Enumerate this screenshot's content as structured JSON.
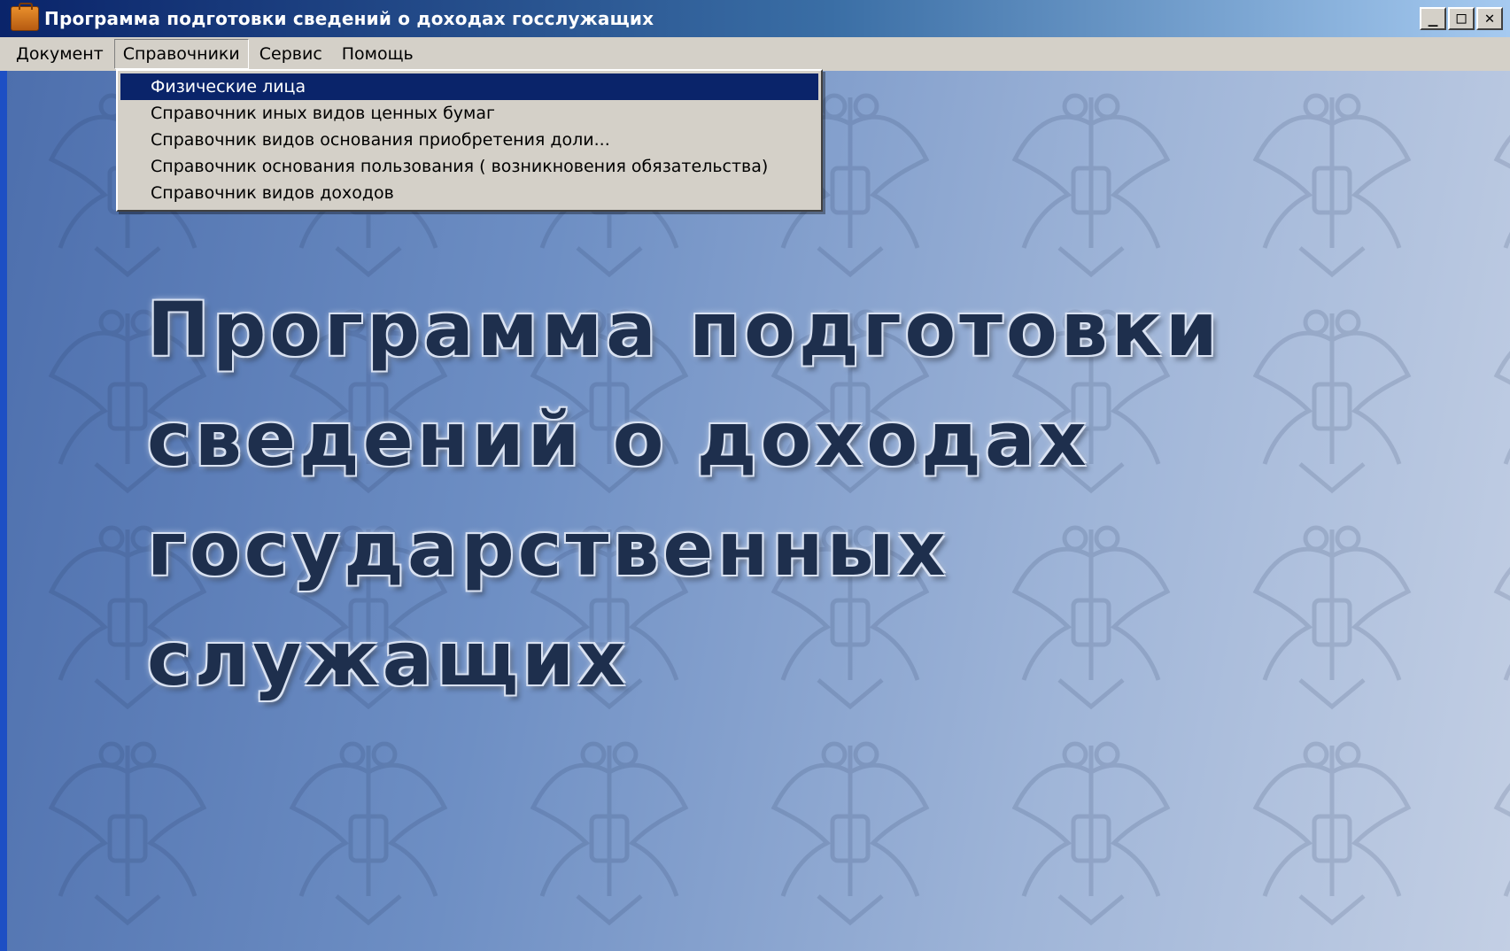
{
  "window": {
    "title": "Программа подготовки сведений о доходах госслужащих",
    "controls": {
      "minimize": "_",
      "maximize": "□",
      "close": "✕"
    }
  },
  "menubar": {
    "items": [
      {
        "label": "Документ"
      },
      {
        "label": "Справочники",
        "active": true
      },
      {
        "label": "Сервис"
      },
      {
        "label": "Помощь"
      }
    ]
  },
  "dropdown": {
    "items": [
      {
        "label": "Физические лица",
        "selected": true
      },
      {
        "label": "Справочник иных видов ценных бумаг"
      },
      {
        "label": "Справочник видов основания приобретения доли..."
      },
      {
        "label": "Справочник основания пользования ( возникновения обязательства)"
      },
      {
        "label": "Справочник видов доходов"
      }
    ]
  },
  "splash": {
    "lines": [
      "Программа подготовки",
      "сведений о доходах",
      "государственных",
      "служащих"
    ]
  },
  "colors": {
    "titlebar_start": "#0a246a",
    "titlebar_end": "#a6caf0",
    "menu_bg": "#d4d0c8",
    "selection": "#0a246a",
    "client_start": "#4d6fad",
    "client_end": "#c3cfe4",
    "splash_text": "#1e2f4d"
  },
  "icons": {
    "app": "briefcase-icon",
    "background_pattern": "double-headed-eagle-emblem"
  }
}
